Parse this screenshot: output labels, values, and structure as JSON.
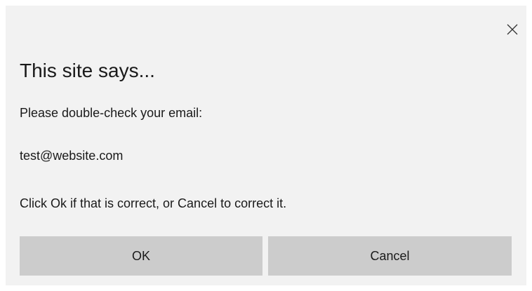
{
  "dialog": {
    "title": "This site says...",
    "lines": [
      "Please double-check your email:",
      "test@website.com",
      "Click Ok if that is correct, or Cancel to correct it."
    ],
    "ok_label": "OK",
    "cancel_label": "Cancel",
    "close_icon": "close-icon"
  }
}
